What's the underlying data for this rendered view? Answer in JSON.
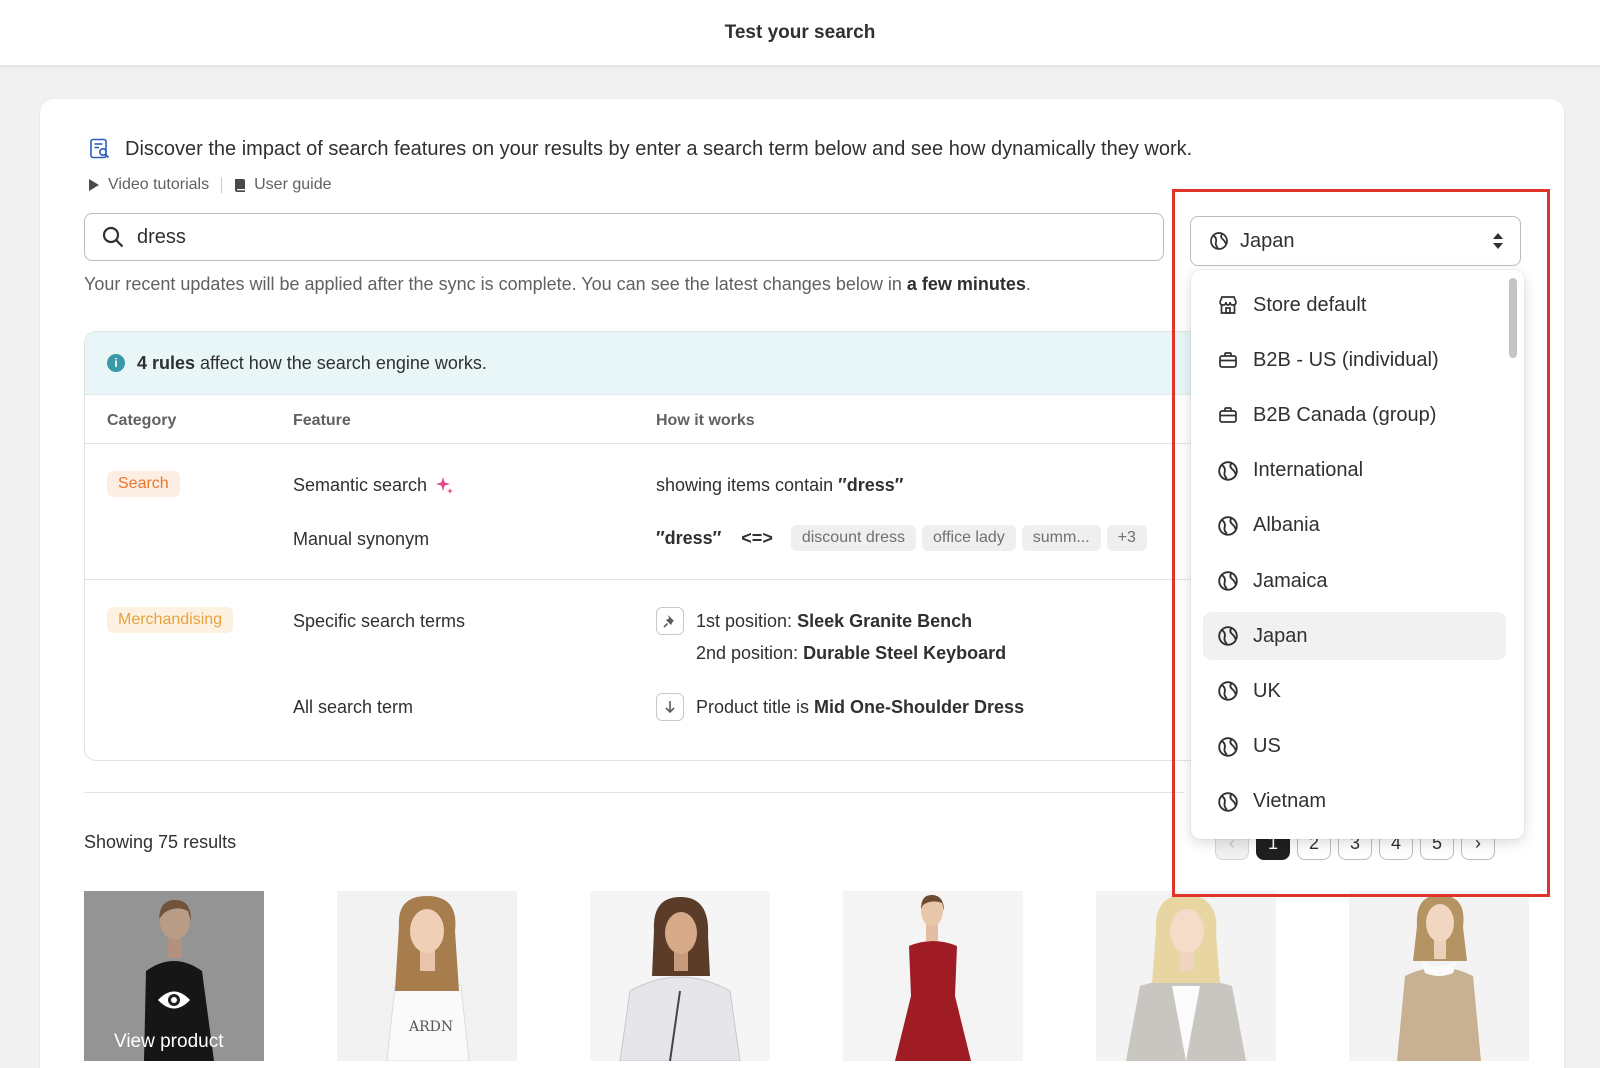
{
  "topbar": {
    "title": "Test your search"
  },
  "intro": {
    "text": "Discover the impact of search features on your results by enter a search term below and see how dynamically they work.",
    "links": [
      {
        "label": "Video tutorials"
      },
      {
        "label": "User guide"
      }
    ]
  },
  "search": {
    "value": "dress"
  },
  "sync_note": {
    "text": "Your recent updates will be applied after the sync is complete. You can see the latest changes below in ",
    "emphasis": "a few minutes",
    "suffix": "."
  },
  "rules": {
    "count_label": "4 rules",
    "banner_suffix": " affect how the search engine works.",
    "headers": {
      "category": "Category",
      "feature": "Feature",
      "how": "How it works"
    },
    "groups": [
      {
        "category": "Search",
        "rows": [
          {
            "feature": "Semantic search",
            "how_prefix": "showing items contain ",
            "how_term": "′′dress′′"
          },
          {
            "feature": "Manual synonym",
            "term": "′′dress′′",
            "op": "<=>",
            "tags": [
              "discount dress",
              "office lady",
              "summ...",
              "+3"
            ]
          }
        ]
      },
      {
        "category": "Merchandising",
        "rows": [
          {
            "feature": "Specific search terms",
            "line1_label": "1st position: ",
            "line1_value": "Sleek Granite Bench",
            "line2_label": "2nd position: ",
            "line2_value": "Durable Steel Keyboard"
          },
          {
            "feature": "All search term",
            "how_label": "Product title is ",
            "how_value": "Mid One-Shoulder Dress"
          }
        ]
      }
    ]
  },
  "results": {
    "count_label": "Showing 75 results",
    "view_label": "View product"
  },
  "pagination": {
    "pages": [
      "1",
      "2",
      "3",
      "4",
      "5"
    ],
    "current": "1",
    "prev": "‹",
    "next": "›"
  },
  "market_select": {
    "value": "Japan",
    "options": [
      {
        "label": "Store default",
        "icon": "store-icon"
      },
      {
        "label": "B2B - US (individual)",
        "icon": "briefcase-icon"
      },
      {
        "label": "B2B Canada (group)",
        "icon": "briefcase-icon"
      },
      {
        "label": "International",
        "icon": "globe-icon"
      },
      {
        "label": "Albania",
        "icon": "globe-icon"
      },
      {
        "label": "Jamaica",
        "icon": "globe-icon"
      },
      {
        "label": "Japan",
        "icon": "globe-icon",
        "selected": true
      },
      {
        "label": "UK",
        "icon": "globe-icon"
      },
      {
        "label": "US",
        "icon": "globe-icon"
      },
      {
        "label": "Vietnam",
        "icon": "globe-icon"
      }
    ]
  },
  "colors": {
    "highlight": "#e0332a",
    "search_badge": "#e8762b",
    "merch_badge": "#e9a13d",
    "info": "#3a99a8",
    "sparkle": "#e0468a"
  }
}
